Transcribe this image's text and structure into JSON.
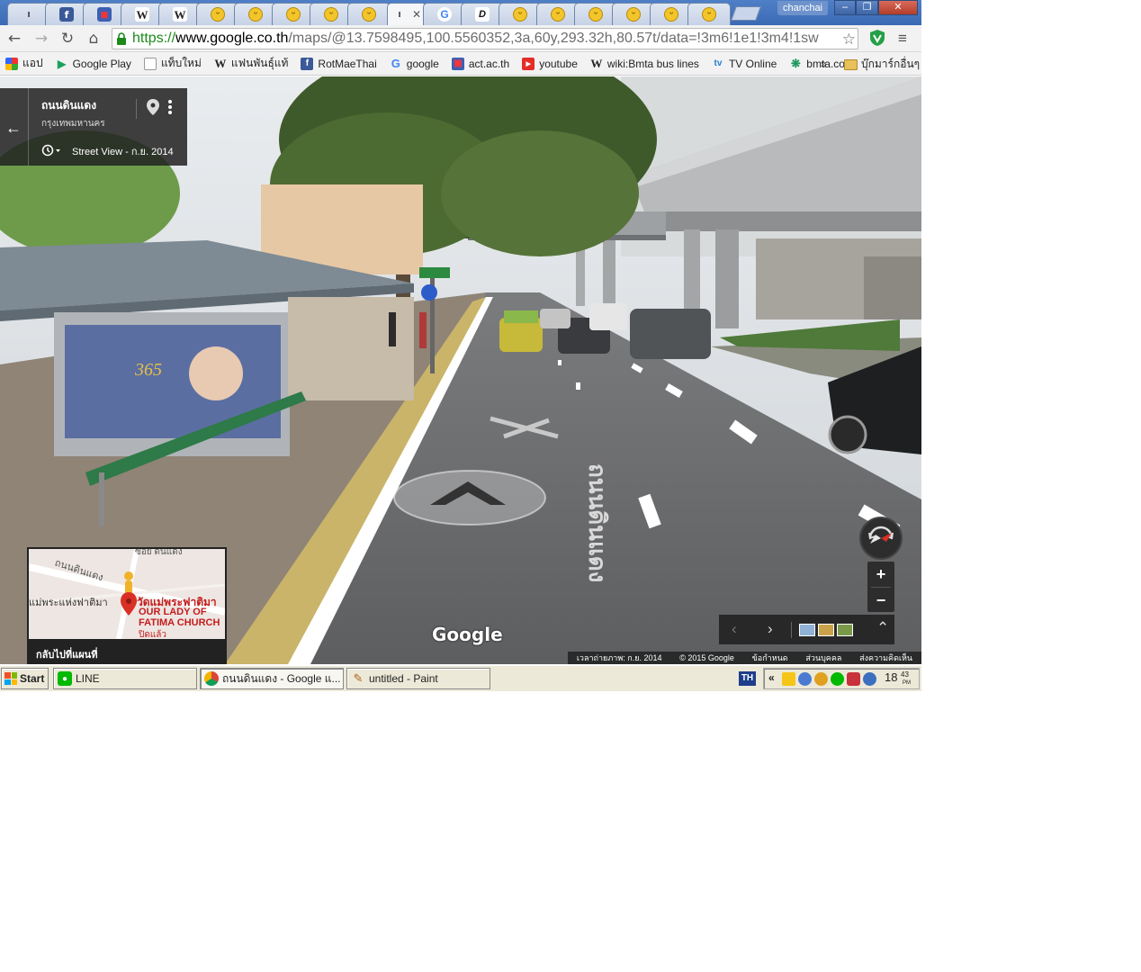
{
  "window": {
    "profile": "chanchai",
    "minimize": "–",
    "restore": "❐",
    "close": "✕"
  },
  "tabs": [
    {
      "icon": "dot",
      "glyph": "ı"
    },
    {
      "icon": "facebook",
      "glyph": "f"
    },
    {
      "icon": "app",
      "glyph": "▣"
    },
    {
      "icon": "wikipedia",
      "glyph": "W"
    },
    {
      "icon": "wikipedia",
      "glyph": "W"
    },
    {
      "icon": "smiley",
      "glyph": "ᵕ"
    },
    {
      "icon": "smiley",
      "glyph": "ᵕ"
    },
    {
      "icon": "smiley",
      "glyph": "ᵕ"
    },
    {
      "icon": "smiley",
      "glyph": "ᵕ"
    },
    {
      "icon": "smiley",
      "glyph": "ᵕ"
    },
    {
      "icon": "dot",
      "glyph": "ı",
      "active": true,
      "close": "✕"
    },
    {
      "icon": "google",
      "glyph": "G"
    },
    {
      "icon": "d-app",
      "glyph": "D"
    },
    {
      "icon": "smiley",
      "glyph": "ᵕ"
    },
    {
      "icon": "smiley",
      "glyph": "ᵕ"
    },
    {
      "icon": "smiley",
      "glyph": "ᵕ"
    },
    {
      "icon": "smiley",
      "glyph": "ᵕ"
    },
    {
      "icon": "smiley",
      "glyph": "ᵕ"
    },
    {
      "icon": "smiley",
      "glyph": "ᵕ"
    }
  ],
  "toolbar": {
    "back": "←",
    "forward": "→",
    "reload": "↻",
    "home": "⌂",
    "url_scheme": "https://",
    "url_host": "www.google.co.th",
    "url_path": "/maps/@13.7598495,100.5560352,3a,60y,293.32h,80.57t/data=!3m6!1e1!3m4!1sw",
    "star": "☆",
    "menu": "≡"
  },
  "bookmarks": {
    "items": [
      {
        "label": "แอป",
        "icon": "apps-grid"
      },
      {
        "label": "Google Play",
        "icon": "play"
      },
      {
        "label": "แท็บใหม่",
        "icon": "page"
      },
      {
        "label": "แฟนพันธุ์แท้",
        "icon": "wikipedia"
      },
      {
        "label": "RotMaeThai",
        "icon": "facebook"
      },
      {
        "label": "google",
        "icon": "google"
      },
      {
        "label": "act.ac.th",
        "icon": "app"
      },
      {
        "label": "youtube",
        "icon": "youtube"
      },
      {
        "label": "wiki:Bmta bus lines",
        "icon": "wikipedia"
      },
      {
        "label": "TV Online",
        "icon": "tv"
      },
      {
        "label": "bmta.co.th",
        "icon": "bmta"
      }
    ],
    "more": "»",
    "other": "บุ๊กมาร์กอื่นๆ"
  },
  "streetview": {
    "place_name": "ถนนดินแดง",
    "place_sub": "กรุงเทพมหานคร",
    "date_label": "Street View - ก.ย. 2014",
    "back": "←",
    "minimap_label": "กลับไปที่แผนที่",
    "minimap": {
      "street1": "ถนนดินแดง",
      "street2": "ซอย ดินแดง",
      "place_left": "แม่พระแห่งฟาติมา",
      "place_thai": "วัดแม่พระฟาติมา",
      "place_en1": "OUR LADY OF",
      "place_en2": "FATIMA CHURCH",
      "closed": "ปิดแล้ว"
    },
    "google_logo": "Google",
    "zoom_in": "+",
    "zoom_out": "−",
    "prev": "‹",
    "next": "›",
    "expand": "⌃",
    "road_text": "ถนนดินแดง",
    "attribution": {
      "capture_date": "เวลาถ่ายภาพ: ก.ย. 2014",
      "copyright": "© 2015 Google",
      "terms": "ข้อกำหนด",
      "privacy": "ส่วนบุคคล",
      "feedback": "ส่งความคิดเห็น"
    }
  },
  "taskbar": {
    "start": "Start",
    "tasks": [
      {
        "label": "LINE",
        "icon": "line"
      },
      {
        "label": "ถนนดินแดง - Google แ...",
        "icon": "chrome",
        "active": true
      },
      {
        "label": "untitled - Paint",
        "icon": "paint"
      }
    ],
    "language": "TH",
    "tray_expand": "«",
    "clock_hour": "18",
    "clock_min": "43",
    "clock_ampm": "PM"
  },
  "colors": {
    "tab_bar": "#3b6ab5",
    "url_scheme": "#1b8a1b",
    "panel_dark": "#222222",
    "taskbar": "#ece9d8"
  }
}
